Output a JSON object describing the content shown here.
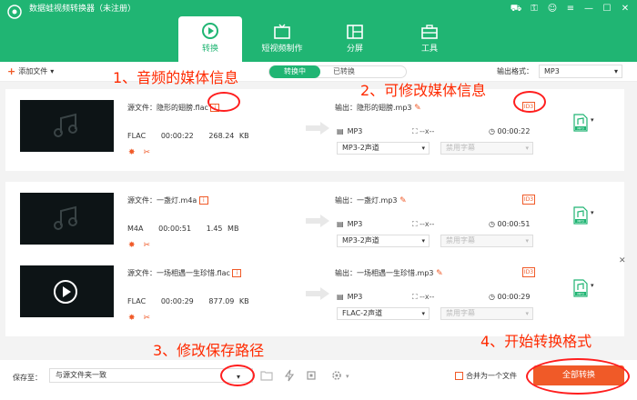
{
  "app": {
    "title": "数据蛙视频转换器（未注册）"
  },
  "tabs": [
    {
      "label": "转换",
      "active": true
    },
    {
      "label": "短视频制作",
      "active": false
    },
    {
      "label": "分屏",
      "active": false
    },
    {
      "label": "工具",
      "active": false
    }
  ],
  "toolbar": {
    "add_file": "添加文件",
    "seg_converting": "转换中",
    "seg_converted": "已转换",
    "format_label": "输出格式：",
    "format_value": "MP3"
  },
  "files": [
    {
      "source": "源文件：隐形的翅膀.flac",
      "format": "FLAC",
      "duration": "00:00:22",
      "size": "268.24 KB",
      "output": "输出：隐形的翅膀.mp3",
      "out_format": "MP3",
      "out_res": "--x--",
      "out_duration": "00:00:22",
      "channel": "MP3-2声道",
      "subtitle": "禁用字幕",
      "thumb": "music"
    },
    {
      "source": "源文件：一盏灯.m4a",
      "format": "M4A",
      "duration": "00:00:51",
      "size": "1.45 MB",
      "output": "输出：一盏灯.mp3",
      "out_format": "MP3",
      "out_res": "--x--",
      "out_duration": "00:00:51",
      "channel": "MP3-2声道",
      "subtitle": "禁用字幕",
      "thumb": "music"
    },
    {
      "source": "源文件：一场相遇一生珍惜.flac",
      "format": "FLAC",
      "duration": "00:00:29",
      "size": "877.09 KB",
      "output": "输出：一场相遇一生珍惜.mp3",
      "out_format": "MP3",
      "out_res": "--x--",
      "out_duration": "00:00:29",
      "channel": "FLAC-2声道",
      "subtitle": "禁用字幕",
      "thumb": "play"
    }
  ],
  "footer": {
    "save_label": "保存至：",
    "save_path": "与源文件夹一致",
    "merge_label": "合并为一个文件",
    "convert_all": "全部转换"
  },
  "annotations": {
    "a1": "1、音频的媒体信息",
    "a2": "2、可修改媒体信息",
    "a3": "3、修改保存路径",
    "a4": "4、开始转换格式"
  },
  "icons": {
    "format_badge": "MP3",
    "media_badge": "i"
  },
  "colors": {
    "brand": "#20b573",
    "accent": "#f05a28",
    "annotation": "#ff2a00"
  }
}
